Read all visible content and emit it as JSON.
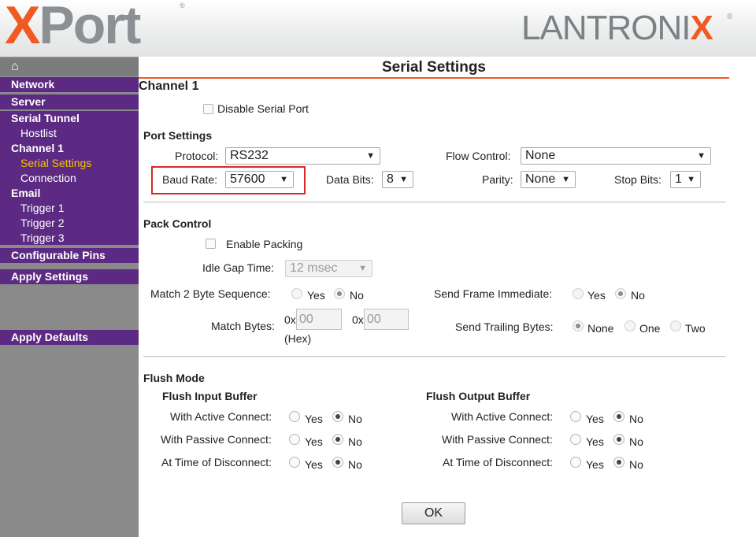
{
  "header": {
    "product_logo_x": "X",
    "product_logo_rest": "Port",
    "product_logo_reg": "®",
    "brand_logo_main": "LANTRONI",
    "brand_logo_x": "X",
    "brand_logo_reg": "®"
  },
  "sidebar": {
    "home_icon": "⌂",
    "network": "Network",
    "server": "Server",
    "serial_tunnel": "Serial Tunnel",
    "hostlist": "Hostlist",
    "channel_1": "Channel 1",
    "serial_settings": "Serial Settings",
    "connection": "Connection",
    "email": "Email",
    "trigger_1": "Trigger 1",
    "trigger_2": "Trigger 2",
    "trigger_3": "Trigger 3",
    "configurable_pins": "Configurable Pins",
    "apply_settings": "Apply Settings",
    "apply_defaults": "Apply Defaults"
  },
  "main": {
    "title": "Serial Settings",
    "channel": "Channel 1",
    "disable_serial_port": "Disable Serial Port",
    "port_settings": {
      "heading": "Port Settings",
      "protocol_label": "Protocol:",
      "protocol_value": "RS232",
      "flow_control_label": "Flow Control:",
      "flow_control_value": "None",
      "baud_rate_label": "Baud Rate:",
      "baud_rate_value": "57600",
      "data_bits_label": "Data Bits:",
      "data_bits_value": "8",
      "parity_label": "Parity:",
      "parity_value": "None",
      "stop_bits_label": "Stop Bits:",
      "stop_bits_value": "1"
    },
    "pack_control": {
      "heading": "Pack Control",
      "enable_packing": "Enable Packing",
      "idle_gap_label": "Idle Gap Time:",
      "idle_gap_value": "12 msec",
      "match_2_byte_label": "Match 2 Byte Sequence:",
      "send_frame_label": "Send Frame Immediate:",
      "match_bytes_label": "Match Bytes:",
      "hex_prefix": "0x",
      "match_byte_1": "00",
      "match_byte_2": "00",
      "hex_note": "(Hex)",
      "send_trailing_label": "Send Trailing Bytes:",
      "yes": "Yes",
      "no": "No",
      "none": "None",
      "one": "One",
      "two": "Two"
    },
    "flush_mode": {
      "heading": "Flush Mode",
      "input_heading": "Flush Input Buffer",
      "output_heading": "Flush Output Buffer",
      "active_connect": "With Active Connect:",
      "passive_connect": "With Passive Connect:",
      "time_of_disconnect": "At Time of Disconnect:",
      "yes": "Yes",
      "no": "No"
    },
    "ok_button": "OK"
  },
  "colors": {
    "accent": "#f05a22",
    "sidebar_purple": "#5c2a83",
    "sidebar_gray": "#8a8a8a",
    "active_item": "#f5c200",
    "highlight_box": "#d42a2a"
  }
}
